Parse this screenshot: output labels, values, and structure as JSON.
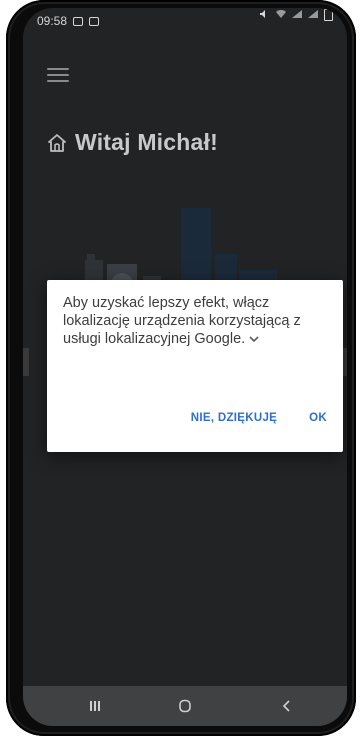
{
  "status_bar": {
    "time": "09:58"
  },
  "header": {
    "title": "Witaj Michał!"
  },
  "dialog": {
    "message": "Aby uzyskać lepszy efekt, włącz lokalizację urządzenia korzystającą z usługi lokalizacyjnej Google.",
    "decline_label": "NIE, DZIĘKUJĘ",
    "accept_label": "OK"
  },
  "colors": {
    "dialog_button": "#2f6fce",
    "scrim": "#222325",
    "nav_bar": "#3f4143"
  },
  "icons": {
    "menu": "hamburger-icon",
    "home": "home-icon",
    "expand": "chevron-down-icon",
    "nav_recents": "recents-icon",
    "nav_home": "home-circle-icon",
    "nav_back": "back-icon"
  }
}
